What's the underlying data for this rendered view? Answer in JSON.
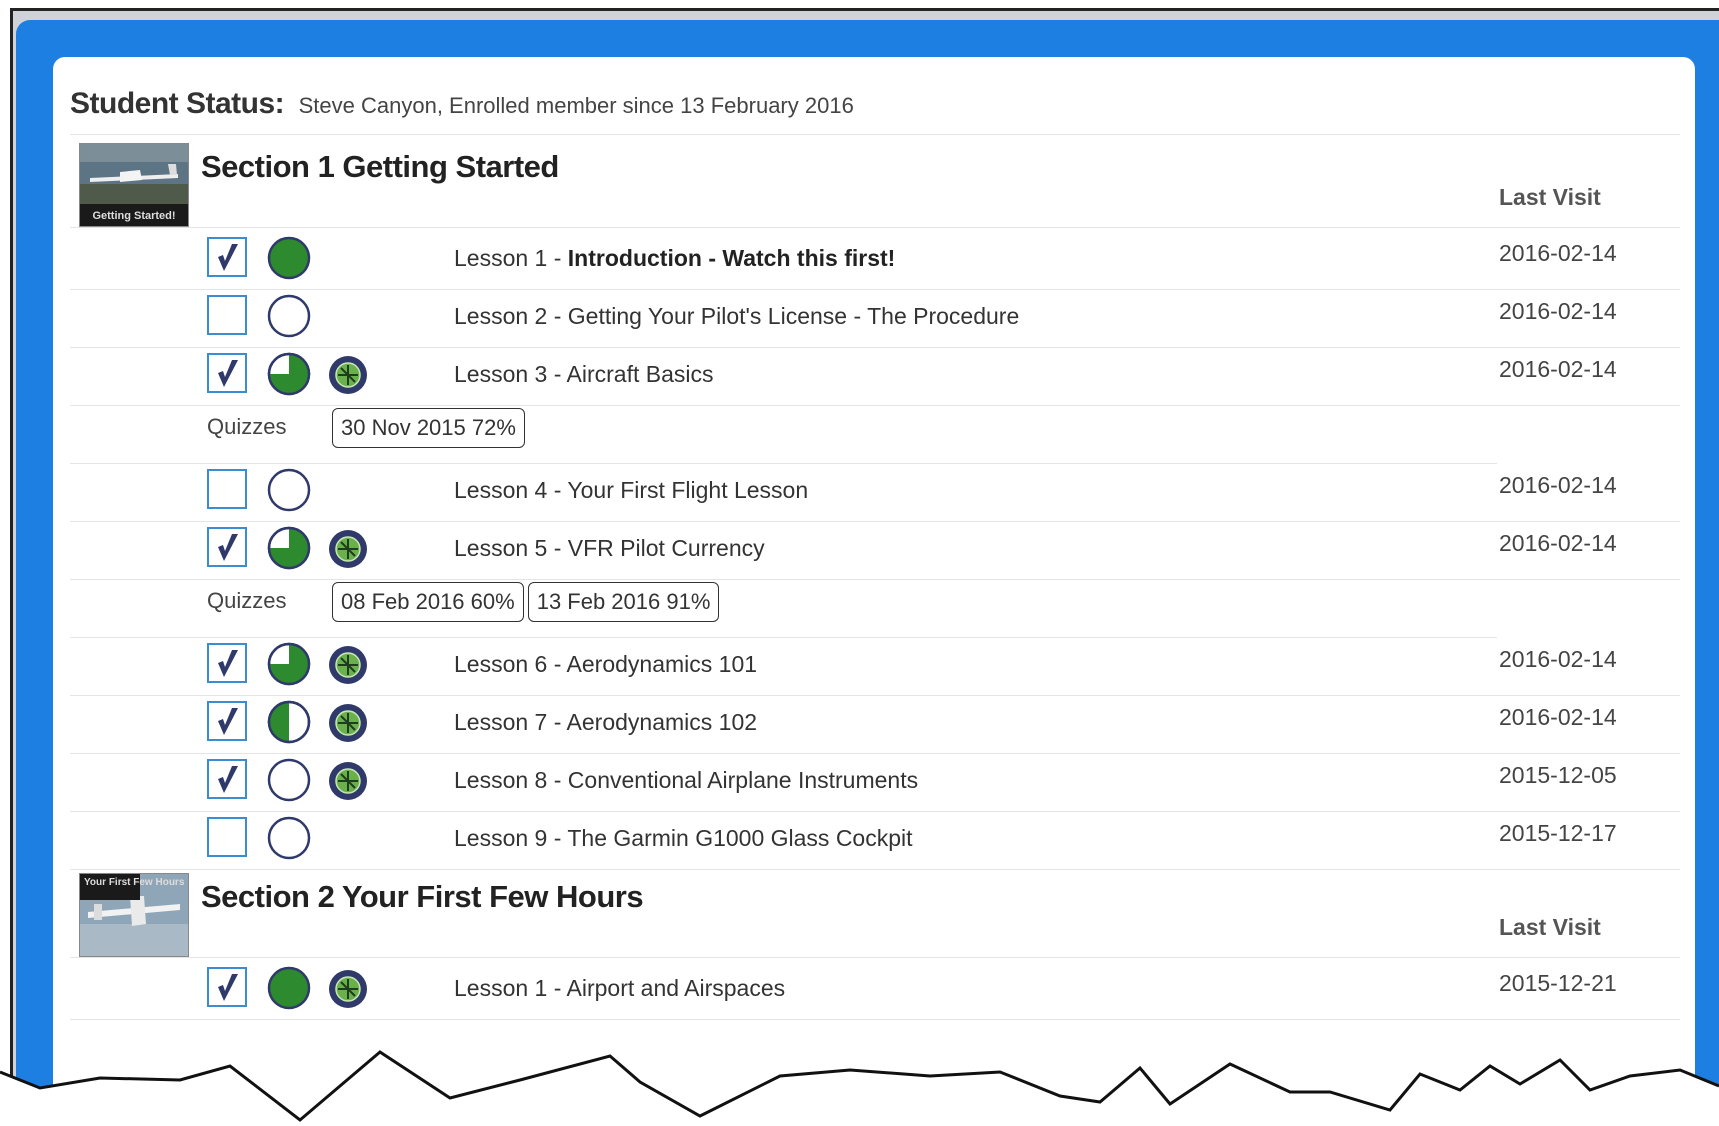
{
  "status": {
    "label": "Student Status:",
    "value": "Steve Canyon, Enrolled member since 13 February 2016"
  },
  "sections": [
    {
      "title": "Section 1 Getting Started",
      "thumb_caption": "Getting Started!",
      "last_visit_header": "Last Visit"
    },
    {
      "title": "Section 2 Your First Few Hours",
      "thumb_caption": "Your First Few Hours",
      "last_visit_header": "Last Visit"
    }
  ],
  "lessons": [
    {
      "prefix": "Lesson 1 - ",
      "title": "Introduction - Watch this first!",
      "date": "2016-02-14",
      "checked": true,
      "progress": 1.0,
      "badge": false,
      "bold": true
    },
    {
      "prefix": "Lesson 2 - ",
      "title": "Getting Your Pilot's License - The Procedure",
      "date": "2016-02-14",
      "checked": false,
      "progress": 0.0,
      "badge": false,
      "bold": false
    },
    {
      "prefix": "Lesson 3 - ",
      "title": "Aircraft Basics",
      "date": "2016-02-14",
      "checked": true,
      "progress": 0.75,
      "badge": true,
      "bold": false
    },
    {
      "prefix": "Lesson 4 - ",
      "title": "Your First Flight Lesson",
      "date": "2016-02-14",
      "checked": false,
      "progress": 0.0,
      "badge": false,
      "bold": false
    },
    {
      "prefix": "Lesson 5 - ",
      "title": "VFR Pilot Currency",
      "date": "2016-02-14",
      "checked": true,
      "progress": 0.75,
      "badge": true,
      "bold": false
    },
    {
      "prefix": "Lesson 6 - ",
      "title": "Aerodynamics 101",
      "date": "2016-02-14",
      "checked": true,
      "progress": 0.75,
      "badge": true,
      "bold": false
    },
    {
      "prefix": "Lesson 7 - ",
      "title": "Aerodynamics 102",
      "date": "2016-02-14",
      "checked": true,
      "progress": 0.5,
      "badge": true,
      "bold": false
    },
    {
      "prefix": "Lesson 8 - ",
      "title": "Conventional Airplane Instruments",
      "date": "2015-12-05",
      "checked": true,
      "progress": 0.0,
      "badge": true,
      "bold": false
    },
    {
      "prefix": "Lesson 9 - ",
      "title": "The Garmin G1000 Glass Cockpit",
      "date": "2015-12-17",
      "checked": false,
      "progress": 0.0,
      "badge": false,
      "bold": false
    },
    {
      "prefix": "Lesson 1 - ",
      "title": "Airport and Airspaces",
      "date": "2015-12-21",
      "checked": true,
      "progress": 1.0,
      "badge": true,
      "bold": false
    }
  ],
  "quizzes": [
    {
      "label": "Quizzes",
      "results": [
        "30 Nov 2015 72%"
      ]
    },
    {
      "label": "Quizzes",
      "results": [
        "08 Feb 2016 60%",
        "13 Feb 2016 91%"
      ]
    }
  ],
  "colors": {
    "frame_blue": "#1e7fe3",
    "progress_green": "#2e8a2e",
    "ring_navy": "#2f3a6b",
    "checkbox_blue": "#3a8dd0"
  },
  "icons": {
    "checkbox": "checkmark-icon",
    "progress": "progress-pie-icon",
    "badge": "quiz-badge-icon"
  }
}
